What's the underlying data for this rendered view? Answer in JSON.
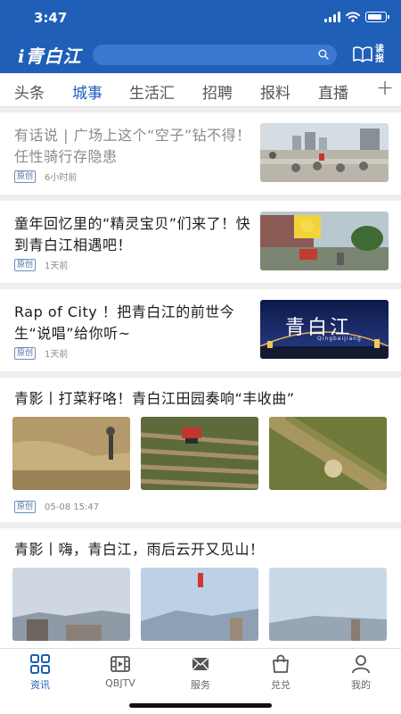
{
  "status_bar": {
    "time": "3:47"
  },
  "header": {
    "logo": "i青白江",
    "reader_label": "读报",
    "accent_color": "#1f5fb8"
  },
  "search": {
    "placeholder": ""
  },
  "tabs": [
    {
      "label": "头条",
      "active": false
    },
    {
      "label": "城事",
      "active": true
    },
    {
      "label": "生活汇",
      "active": false
    },
    {
      "label": "招聘",
      "active": false
    },
    {
      "label": "报料",
      "active": false
    },
    {
      "label": "直播",
      "active": false
    }
  ],
  "tab_add_label": "+",
  "articles": [
    {
      "title": "有话说 | 广场上这个“空子”钻不得！任性骑行存隐患",
      "badge": "原创",
      "time": "6小时前",
      "read": true
    },
    {
      "title": "童年回忆里的“精灵宝贝”们来了！快到青白江相遇吧！",
      "badge": "原创",
      "time": "1天前",
      "read": false
    },
    {
      "title": "Rap of City ！把青白江的前世今生“说唱”给你听~",
      "badge": "原创",
      "time": "1天前",
      "read": false,
      "thumb_brand": "青白江",
      "thumb_brand_sub": "Qingbaijiang"
    },
    {
      "title": "青影丨打菜籽咯！青白江田园奏响“丰收曲”",
      "badge": "原创",
      "time": "05-08 15:47"
    },
    {
      "title": "青影丨嗨，青白江，雨后云开又见山！"
    }
  ],
  "bottom_nav": [
    {
      "label": "资讯",
      "icon": "grid-icon",
      "active": true
    },
    {
      "label": "QBJTV",
      "icon": "film-icon",
      "active": false
    },
    {
      "label": "服务",
      "icon": "envelope-icon",
      "active": false
    },
    {
      "label": "兑兑",
      "icon": "shopping-bag-icon",
      "active": false
    },
    {
      "label": "我的",
      "icon": "person-icon",
      "active": false
    }
  ]
}
